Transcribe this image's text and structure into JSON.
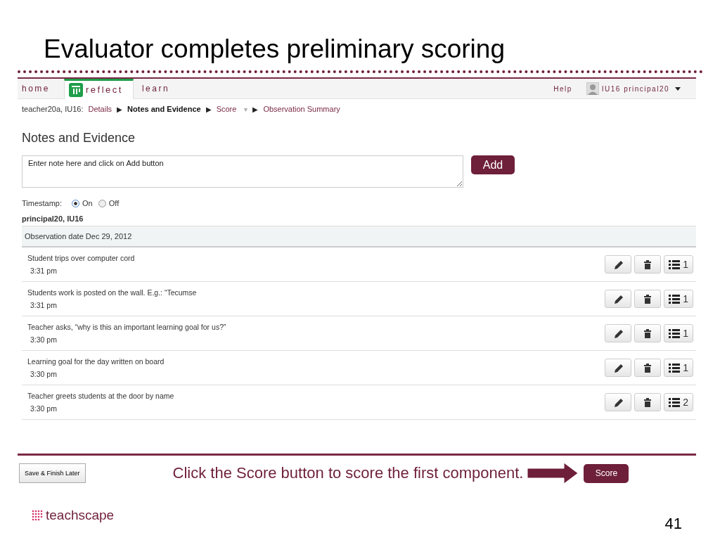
{
  "slide": {
    "title": "Evaluator completes preliminary scoring",
    "caption": "Click the Score button to score the first component.",
    "logo": "teachscape",
    "page_number": "41"
  },
  "nav": {
    "tabs": [
      {
        "label": "home",
        "selected": false
      },
      {
        "label": "reflect",
        "selected": true
      },
      {
        "label": "learn",
        "selected": false
      }
    ],
    "help": "Help",
    "user": "IU16 principal20"
  },
  "breadcrumb": {
    "prefix": "teacher20a, IU16:",
    "separator": "▶",
    "items": [
      {
        "label": "Details",
        "current": false
      },
      {
        "label": "Notes and Evidence",
        "current": true
      },
      {
        "label": "Score",
        "current": false,
        "caret": "▾"
      },
      {
        "label": "Observation Summary",
        "current": false
      }
    ]
  },
  "notes": {
    "heading": "Notes and Evidence",
    "input": {
      "placeholder": "Enter note here and click on Add button"
    },
    "add_button": "Add",
    "timestamp": {
      "label": "Timestamp:",
      "options": [
        {
          "label": "On",
          "selected": true
        },
        {
          "label": "Off",
          "selected": false
        }
      ]
    },
    "author": "principal20, IU16",
    "date_header": "Observation date Dec 29, 2012",
    "entries": [
      {
        "text": "Student trips over computer cord",
        "time": "3:31 pm",
        "count": "1"
      },
      {
        "text": "Students work is posted on the wall. E.g.: “Tecumse",
        "time": "3:31 pm",
        "count": "1"
      },
      {
        "text": "Teacher asks, “why is this an important learning goal for us?”",
        "time": "3:30 pm",
        "count": "1"
      },
      {
        "text": "Learning goal for the day written on board",
        "time": "3:30 pm",
        "count": "1"
      },
      {
        "text": "Teacher greets students at the door by name",
        "time": "3:30 pm",
        "count": "2"
      }
    ]
  },
  "footer": {
    "save_button": "Save & Finish Later",
    "score_button": "Score"
  }
}
